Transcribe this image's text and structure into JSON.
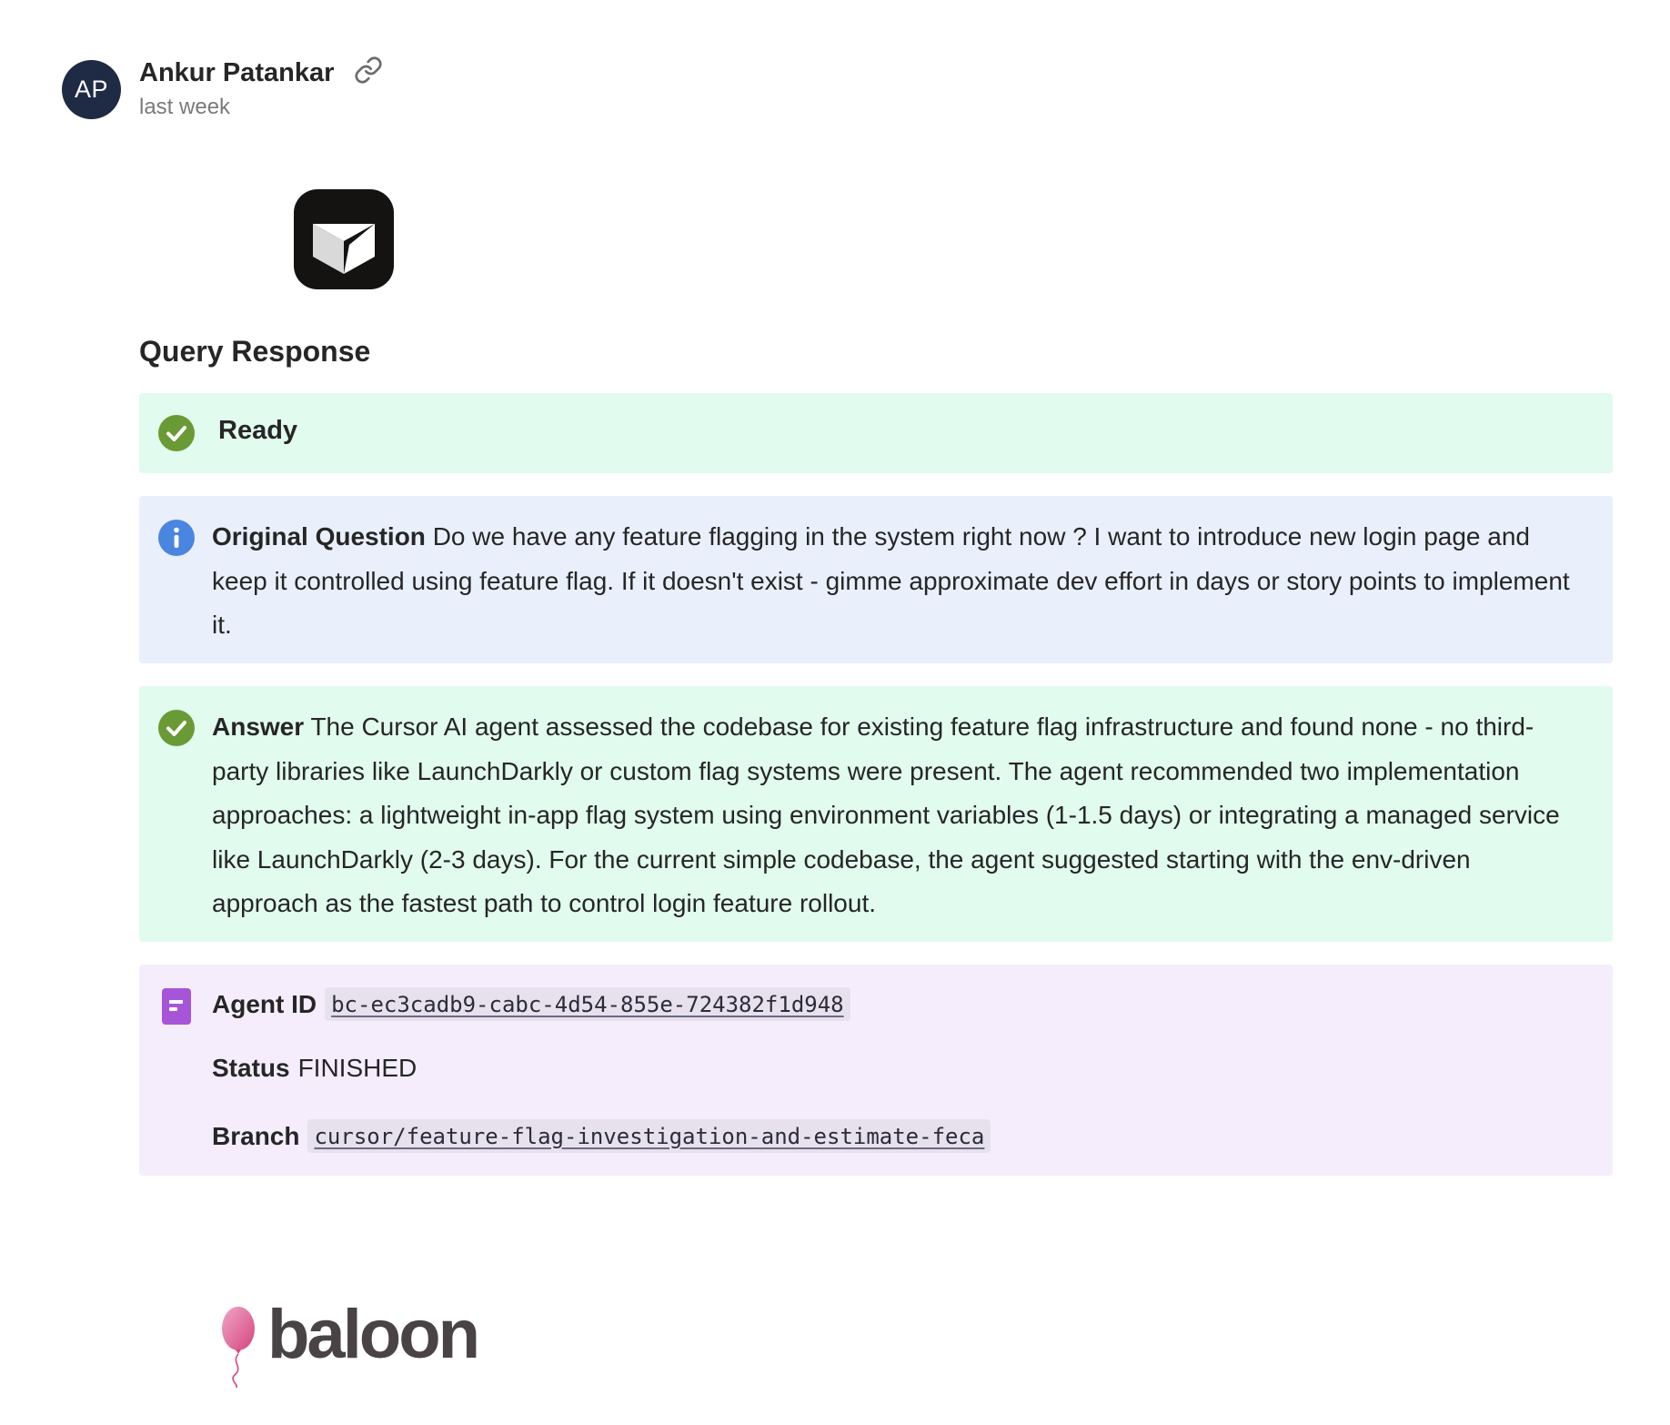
{
  "author": {
    "initials": "AP",
    "name": "Ankur Patankar",
    "timestamp": "last week",
    "link_icon": "link-icon"
  },
  "section_heading": "Query Response",
  "ready": {
    "label": "Ready",
    "icon": "check-circle-icon",
    "color": "#6a9a35"
  },
  "question": {
    "label": "Original Question",
    "text": "Do we have any feature flagging in the system right now ? I want to introduce new login page and keep it controlled using feature flag. If it doesn't exist - gimme approximate dev effort in days or story points to implement it.",
    "icon": "info-icon",
    "color": "#4a86e0"
  },
  "answer": {
    "label": "Answer",
    "text": "The Cursor AI agent assessed the codebase for existing feature flag infrastructure and found none - no third-party libraries like LaunchDarkly or custom flag systems were present. The agent recommended two implementation approaches: a lightweight in-app flag system using environment variables (1-1.5 days) or integrating a managed service like LaunchDarkly (2-3 days). For the current simple codebase, the agent suggested starting with the env-driven approach as the fastest path to control login feature rollout.",
    "icon": "check-circle-icon",
    "color": "#6a9a35"
  },
  "agent": {
    "icon": "document-icon",
    "color": "#a655d8",
    "id_label": "Agent ID",
    "id_value": "bc-ec3cadb9-cabc-4d54-855e-724382f1d948",
    "status_label": "Status",
    "status_value": "FINISHED",
    "branch_label": "Branch",
    "branch_value": "cursor/feature-flag-investigation-and-estimate-feca"
  },
  "logos": {
    "cursor_logo": "cursor-logo",
    "footer_brand": "baloon"
  }
}
